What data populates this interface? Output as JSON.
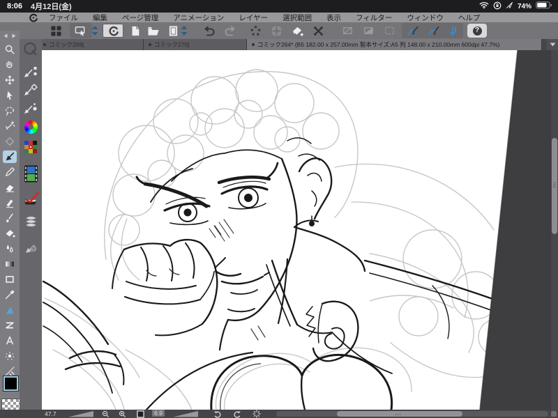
{
  "status_bar": {
    "time": "8:06",
    "date": "4月12日(金)",
    "battery_percent": "74%",
    "icons": [
      "wifi-icon",
      "orientation-lock-icon",
      "location-arrow-icon",
      "battery-icon"
    ]
  },
  "menu_bar": {
    "logo_icon": "clip-studio-logo-icon",
    "items": [
      "ファイル",
      "編集",
      "ページ管理",
      "アニメーション",
      "レイヤー",
      "選択範囲",
      "表示",
      "フィルター",
      "ウィンドウ",
      "ヘルプ"
    ]
  },
  "toolbar": {
    "help_glyph": "?",
    "buttons": [
      "apps-grid",
      "display-cast",
      "canvas-stepper",
      "clip-studio-start",
      "new-file",
      "open-file",
      "page",
      "page-stepper",
      "undo",
      "redo",
      "touch-gesture",
      "pan-pad",
      "fill-bucket",
      "transform",
      "layer-blocked",
      "layer-half",
      "selection-dashed",
      "vector-line-pen",
      "vector-curve-pen",
      "stroke-direction",
      "help"
    ]
  },
  "tab_bar": {
    "overflow_icon": "chevron-down-icon",
    "tabs": [
      {
        "label": "コミック269[",
        "active": false
      },
      {
        "label": "コミック270[",
        "active": false
      },
      {
        "label": "コミック264* (B5 182.00 x 257.00mm 製本サイズ:A5 判 148.00 x 210.00mm 600dpi 47.7%)",
        "active": true
      }
    ]
  },
  "tool_panel": {
    "tools": [
      "zoom",
      "hand",
      "move",
      "operate",
      "lasso",
      "auto-select",
      "frame",
      "pen",
      "pencil",
      "eraser",
      "marker",
      "brush",
      "fill",
      "blend",
      "gradient",
      "frame-border",
      "eyedropper",
      "figure",
      "panel",
      "text",
      "spray",
      "ruler"
    ],
    "selected_tool": "pen",
    "foreground_color": "#000000",
    "background_color": "#ffffff"
  },
  "palette_dock": {
    "items": [
      "quick-launch",
      "sub-tool",
      "tool-property",
      "brush-size",
      "color-wheel",
      "color-set",
      "timeline",
      "auto-action",
      "material",
      "decoration"
    ]
  },
  "bottom_bar": {
    "zoom_percent": "47.7",
    "rotate_angle": "6.9",
    "icons": [
      "zoom-slider-icon",
      "zoom-out-icon",
      "zoom-in-icon",
      "fit-screen-icon",
      "rotate-slider-icon",
      "rotate-left-icon",
      "rotate-right-icon",
      "reset-rotation-icon"
    ]
  },
  "colors": {
    "selected_tool_bg": "#b5d2e4",
    "accent_blue": "#3f86c0",
    "canvas_outside": "#3e3e41",
    "menu_bg": "#98989b",
    "toolbar_bg": "#757579"
  }
}
